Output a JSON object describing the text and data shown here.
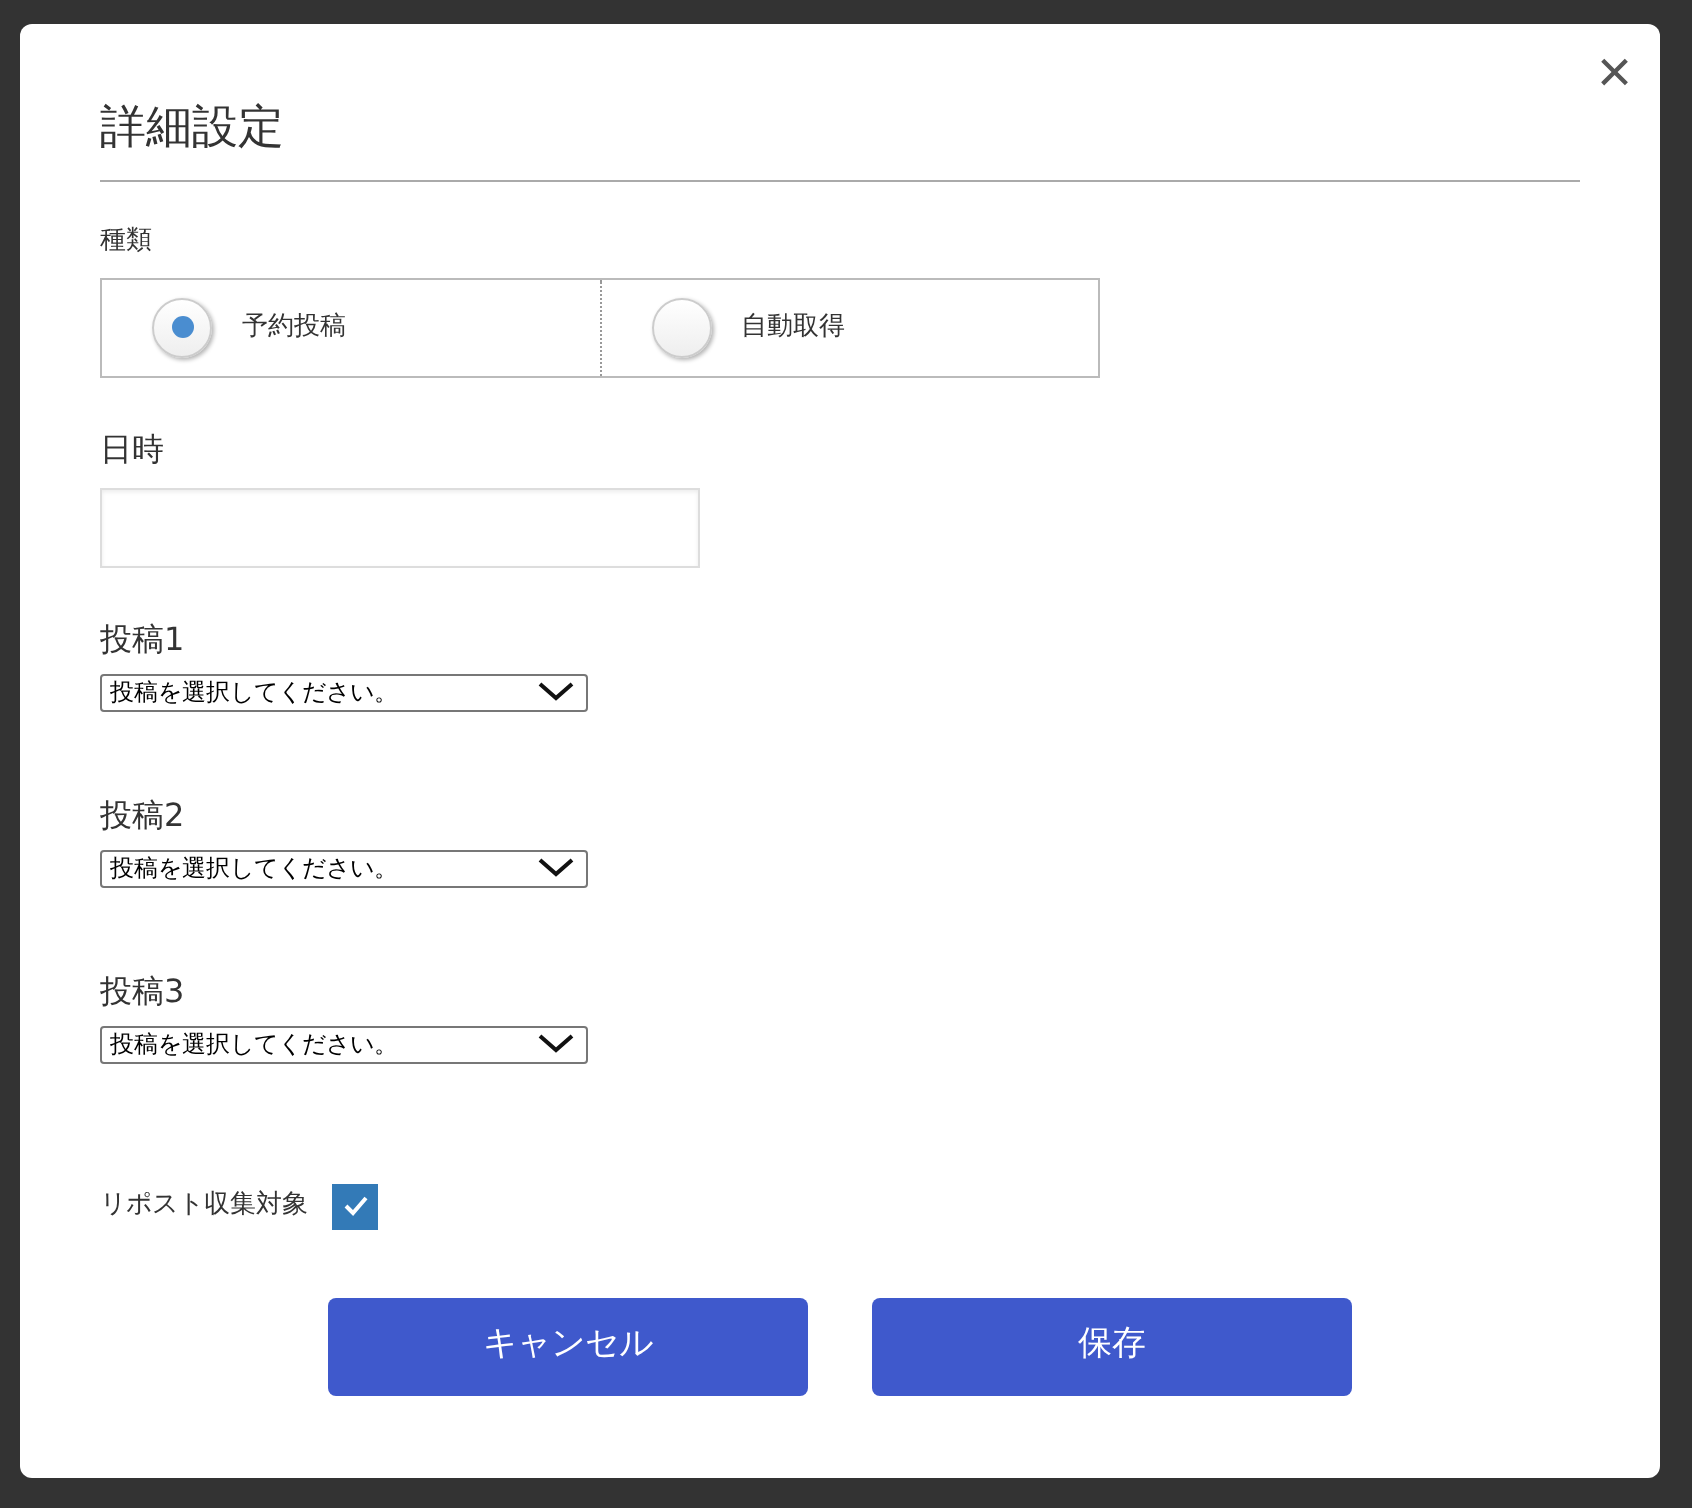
{
  "dialog": {
    "title": "詳細設定",
    "close": "×"
  },
  "type_field": {
    "label": "種類",
    "options": [
      {
        "label": "予約投稿",
        "selected": true
      },
      {
        "label": "自動取得",
        "selected": false
      }
    ]
  },
  "datetime_field": {
    "label": "日時"
  },
  "posts": [
    {
      "label": "投稿1",
      "value": "投稿を選択してください。"
    },
    {
      "label": "投稿2",
      "value": "投稿を選択してください。"
    },
    {
      "label": "投稿3",
      "value": "投稿を選択してください。"
    }
  ],
  "repost": {
    "label": "リポスト収集対象",
    "checked": true
  },
  "buttons": [
    {
      "label": "キャンセル"
    },
    {
      "label": "保存"
    }
  ]
}
